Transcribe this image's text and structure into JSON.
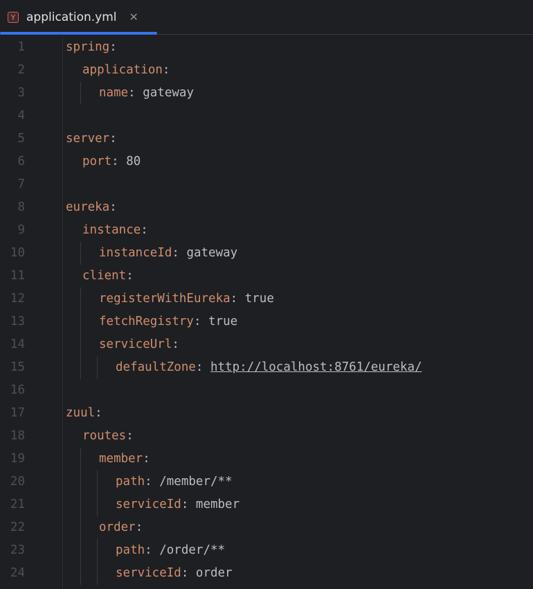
{
  "tab": {
    "icon": "yaml-file-icon",
    "icon_glyph": "Y",
    "title": "application.yml",
    "close_glyph": "✕"
  },
  "lines": [
    {
      "n": "1",
      "indent": 0,
      "key": "spring",
      "colon": ":",
      "value": ""
    },
    {
      "n": "2",
      "indent": 1,
      "key": "application",
      "colon": ":",
      "value": ""
    },
    {
      "n": "3",
      "indent": 2,
      "key": "name",
      "colon": ": ",
      "value": "gateway"
    },
    {
      "n": "4",
      "indent": 0,
      "key": "",
      "colon": "",
      "value": ""
    },
    {
      "n": "5",
      "indent": 0,
      "key": "server",
      "colon": ":",
      "value": ""
    },
    {
      "n": "6",
      "indent": 1,
      "key": "port",
      "colon": ": ",
      "value": "80"
    },
    {
      "n": "7",
      "indent": 0,
      "key": "",
      "colon": "",
      "value": ""
    },
    {
      "n": "8",
      "indent": 0,
      "key": "eureka",
      "colon": ":",
      "value": ""
    },
    {
      "n": "9",
      "indent": 1,
      "key": "instance",
      "colon": ":",
      "value": ""
    },
    {
      "n": "10",
      "indent": 2,
      "key": "instanceId",
      "colon": ": ",
      "value": "gateway"
    },
    {
      "n": "11",
      "indent": 1,
      "key": "client",
      "colon": ":",
      "value": ""
    },
    {
      "n": "12",
      "indent": 2,
      "key": "registerWithEureka",
      "colon": ": ",
      "value": "true"
    },
    {
      "n": "13",
      "indent": 2,
      "key": "fetchRegistry",
      "colon": ": ",
      "value": "true"
    },
    {
      "n": "14",
      "indent": 2,
      "key": "serviceUrl",
      "colon": ":",
      "value": ""
    },
    {
      "n": "15",
      "indent": 3,
      "key": "defaultZone",
      "colon": ": ",
      "value": "http://localhost:8761/eureka/",
      "link": true
    },
    {
      "n": "16",
      "indent": 0,
      "key": "",
      "colon": "",
      "value": ""
    },
    {
      "n": "17",
      "indent": 0,
      "key": "zuul",
      "colon": ":",
      "value": ""
    },
    {
      "n": "18",
      "indent": 1,
      "key": "routes",
      "colon": ":",
      "value": ""
    },
    {
      "n": "19",
      "indent": 2,
      "key": "member",
      "colon": ":",
      "value": ""
    },
    {
      "n": "20",
      "indent": 3,
      "key": "path",
      "colon": ": ",
      "value": "/member/**"
    },
    {
      "n": "21",
      "indent": 3,
      "key": "serviceId",
      "colon": ": ",
      "value": "member"
    },
    {
      "n": "22",
      "indent": 2,
      "key": "order",
      "colon": ":",
      "value": ""
    },
    {
      "n": "23",
      "indent": 3,
      "key": "path",
      "colon": ": ",
      "value": "/order/**"
    },
    {
      "n": "24",
      "indent": 3,
      "key": "serviceId",
      "colon": ": ",
      "value": "order"
    }
  ]
}
